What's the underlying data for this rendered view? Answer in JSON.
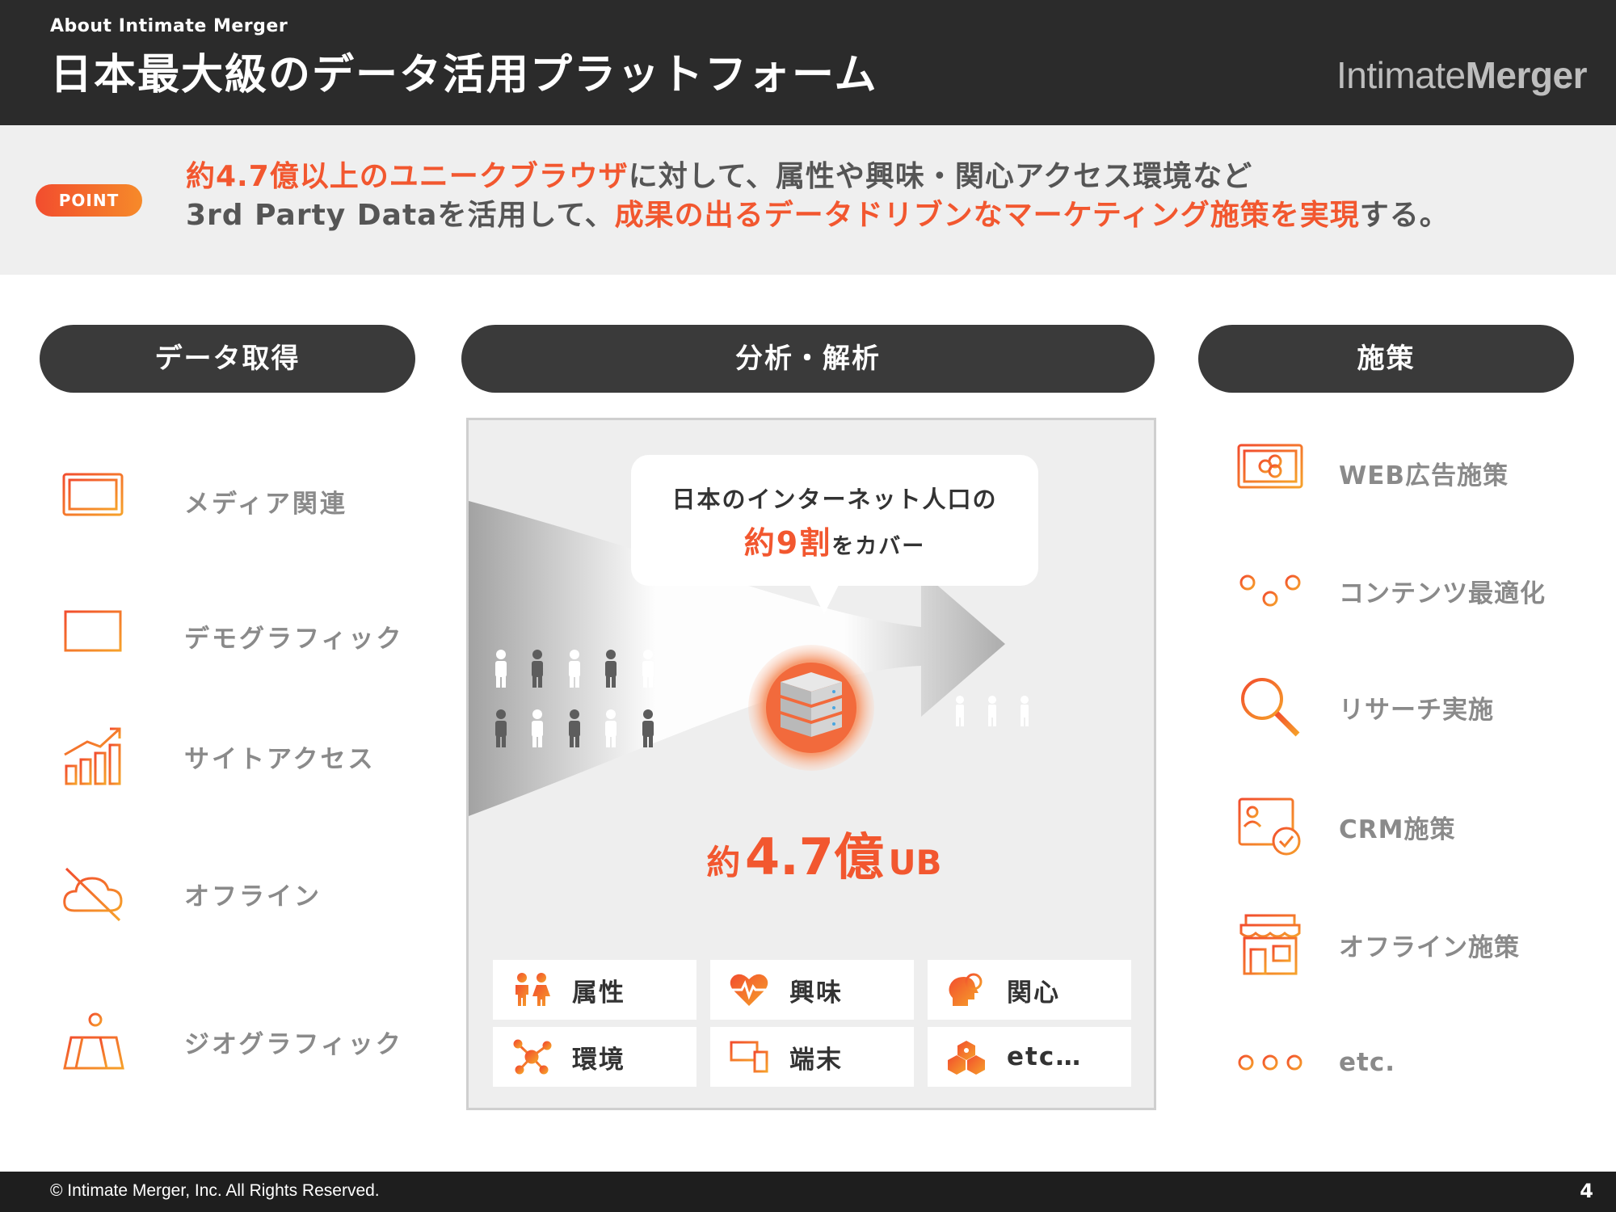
{
  "header": {
    "eyebrow": "About Intimate Merger",
    "title": "日本最大級のデータ活用プラットフォーム",
    "logo_part1": "Intimate",
    "logo_part2": "Merger"
  },
  "point": {
    "badge": "POINT",
    "line1_hl": "約4.7億以上のユニークブラウザ",
    "line1_rest": "に対して、属性や興味・関心アクセス環境など",
    "line2_start": "3rd Party Dataを活用して、",
    "line2_hl": "成果の出るデータドリブンなマーケティング施策を実現",
    "line2_end": "する。"
  },
  "sections": {
    "acquire": "データ取得",
    "analyze": "分析・解析",
    "action": "施策"
  },
  "left_items": [
    {
      "label": "メディア関連",
      "icon": "monitor-icon"
    },
    {
      "label": "デモグラフィック",
      "icon": "presentation-board-icon"
    },
    {
      "label": "サイトアクセス",
      "icon": "bar-chart-growth-icon"
    },
    {
      "label": "オフライン",
      "icon": "cloud-offline-icon"
    },
    {
      "label": "ジオグラフィック",
      "icon": "map-pin-icon"
    }
  ],
  "right_items": [
    {
      "label": "WEB広告施策",
      "icon": "web-ad-monitor-icon"
    },
    {
      "label": "コンテンツ最適化",
      "icon": "sliders-icon"
    },
    {
      "label": "リサーチ実施",
      "icon": "magnifier-icon"
    },
    {
      "label": "CRM施策",
      "icon": "crm-card-icon"
    },
    {
      "label": "オフライン施策",
      "icon": "storefront-icon"
    },
    {
      "label": "etc.",
      "icon": "dots-icon"
    }
  ],
  "center": {
    "bubble_line1": "日本のインターネット人口の",
    "bubble_big": "約9割",
    "bubble_rest": "をカバー",
    "stat_prefix": "約",
    "stat_value": "4.7億",
    "stat_suffix": "UB",
    "tags": [
      {
        "label": "属性",
        "icon": "people-icon"
      },
      {
        "label": "興味",
        "icon": "heart-pulse-icon"
      },
      {
        "label": "関心",
        "icon": "head-idea-icon"
      },
      {
        "label": "環境",
        "icon": "network-icon"
      },
      {
        "label": "端末",
        "icon": "devices-icon"
      },
      {
        "label": "etc…",
        "icon": "cubes-icon"
      }
    ]
  },
  "colors": {
    "accent": "#f2572f",
    "accent2": "#f68a2a",
    "dark": "#2b2b2b",
    "band": "#efefef"
  },
  "footer": {
    "copyright": "© Intimate Merger, Inc. All Rights Reserved.",
    "page": "4"
  }
}
